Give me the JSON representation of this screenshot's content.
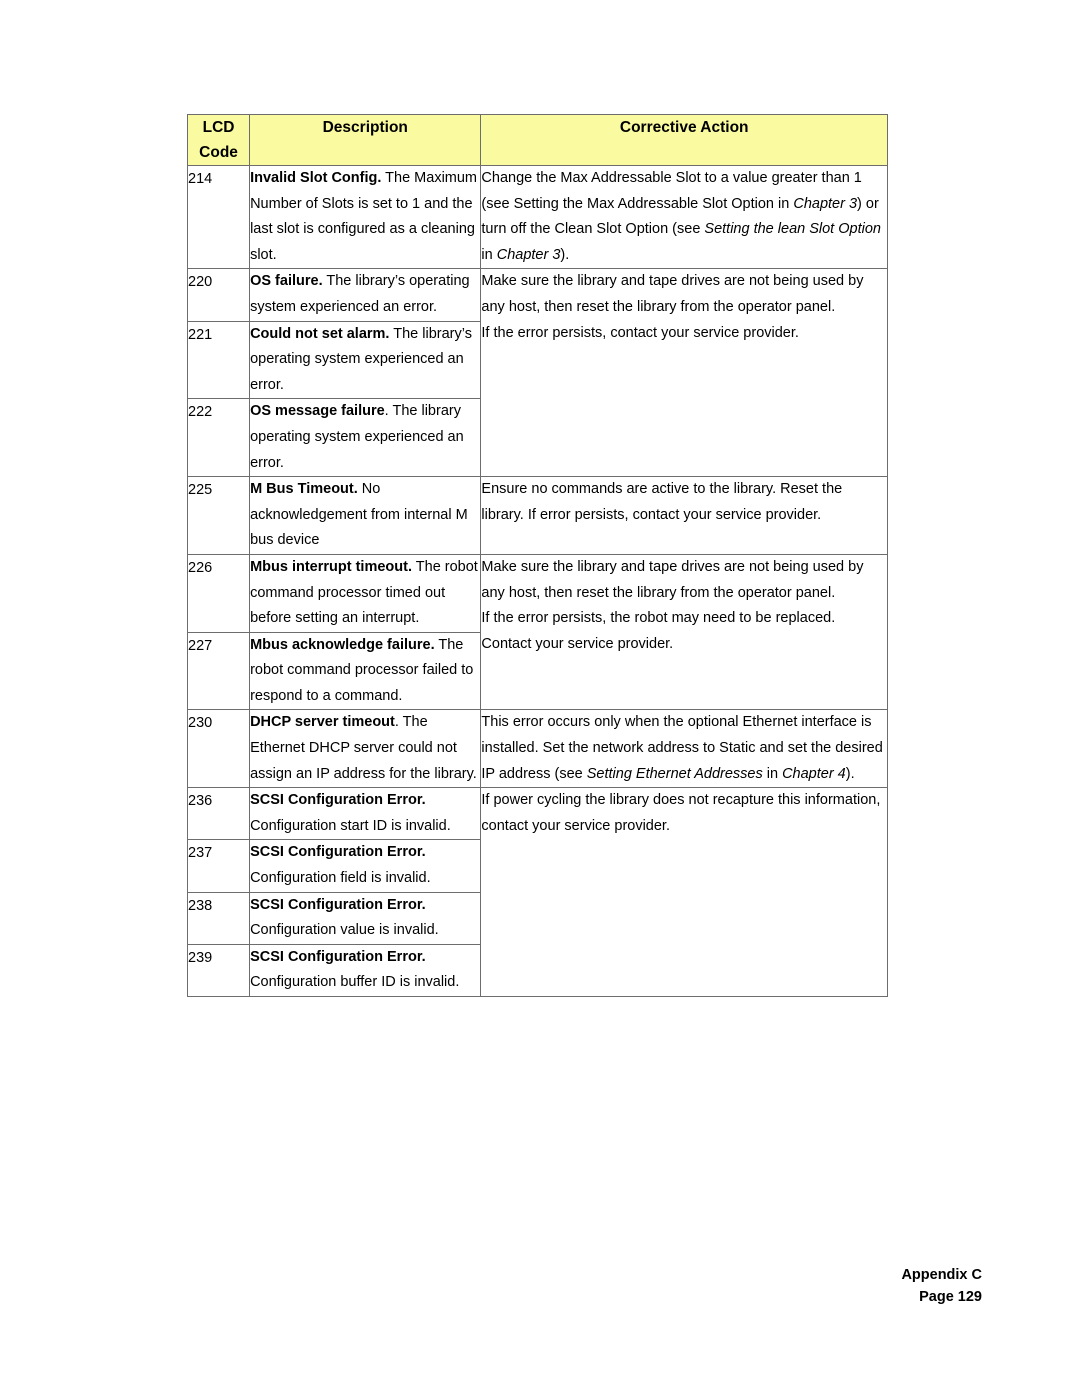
{
  "page": {
    "footer": {
      "appendix": "Appendix C",
      "page_number": "Page 129"
    }
  },
  "table": {
    "headers": {
      "code": "LCD\nCode",
      "code_line1": "LCD",
      "code_line2": "Code",
      "description": "Description",
      "corrective_action": "Corrective Action"
    },
    "header_bg": "#fafaa0",
    "rows": [
      {
        "code": "214",
        "description_html": "<b>Invalid Slot Config.</b> The Maximum Number of Slots is set to 1 and the last slot is configured as a cleaning slot.",
        "description_text": "Invalid Slot Config. The Maximum Number of Slots is set to 1 and the last slot is configured as a cleaning slot.",
        "corrective_html": "Change the Max Addressable Slot to a value greater than 1 (see Setting the Max Addressable Slot Option in <i>Chapter 3</i>) or turn off the Clean Slot Option (see <i>Setting the lean Slot Option</i> in <i>Chapter 3</i>).",
        "corrective_text": "Change the Max Addressable Slot to a value greater than 1 (see Setting the Max Addressable Slot Option in Chapter 3) or turn off the Clean Slot Option (see Setting the lean Slot Option in Chapter 3).",
        "corrective_rowspan": 1
      },
      {
        "code": "220",
        "description_html": "<b>OS failure.</b> The library’s operating system experienced an error.",
        "description_text": "OS failure. The library’s operating system experienced an error.",
        "corrective_html": "Make sure the library and tape drives are not being used by any host, then reset the library from the operator panel.<br>If the error persists, contact your service provider.",
        "corrective_text": "Make sure the library and tape drives are not being used by any host, then reset the library from the operator panel. If the error persists, contact your service provider.",
        "corrective_rowspan": 3
      },
      {
        "code": "221",
        "description_html": "<b>Could not set alarm.</b> The library’s operating system experienced an error.",
        "description_text": "Could not set alarm. The library’s operating system experienced an error.",
        "corrective_html": null,
        "corrective_text": null,
        "corrective_rowspan": 0
      },
      {
        "code": "222",
        "description_html": "<b>OS message failure</b>. The library operating system experienced an error.",
        "description_text": "OS message failure. The library operating system experienced an error.",
        "corrective_html": null,
        "corrective_text": null,
        "corrective_rowspan": 0
      },
      {
        "code": "225",
        "description_html": "<b>M Bus Timeout.</b> No acknowledgement from internal M bus device",
        "description_text": "M Bus Timeout. No acknowledgement from internal M bus device",
        "corrective_html": "Ensure no commands are active to the library. Reset the library. If error persists, contact your service provider.",
        "corrective_text": "Ensure no commands are active to the library. Reset the library. If error persists, contact your service provider.",
        "corrective_rowspan": 1
      },
      {
        "code": "226",
        "description_html": "<b>Mbus interrupt timeout.</b> The robot command processor timed out before setting an interrupt.",
        "description_text": "Mbus interrupt timeout. The robot command processor timed out before setting an interrupt.",
        "corrective_html": "Make sure the library and tape drives are not being used by any host, then reset the library from the operator panel.<br>If the error persists, the robot may need to be replaced. Contact your service provider.",
        "corrective_text": "Make sure the library and tape drives are not being used by any host, then reset the library from the operator panel. If the error persists, the robot may need to be replaced. Contact your service provider.",
        "corrective_rowspan": 2
      },
      {
        "code": "227",
        "description_html": "<b>Mbus acknowledge failure.</b> The robot command processor failed to respond to a command.",
        "description_text": "Mbus acknowledge failure. The robot command processor failed to respond to a command.",
        "corrective_html": null,
        "corrective_text": null,
        "corrective_rowspan": 0
      },
      {
        "code": "230",
        "description_html": "<b>DHCP server timeout</b>. The Ethernet DHCP server could not assign an IP address for the library.",
        "description_text": "DHCP server timeout. The Ethernet DHCP server could not assign an IP address for the library.",
        "corrective_html": "This error occurs only when the optional Ethernet interface is installed. Set the network address to Static and set the desired IP address (see <i>Setting Ethernet Addresses</i> in <i>Chapter 4</i>).",
        "corrective_text": "This error occurs only when the optional Ethernet interface is installed. Set the network address to Static and set the desired IP address (see Setting Ethernet Addresses in Chapter 4).",
        "corrective_rowspan": 1
      },
      {
        "code": "236",
        "description_html": "<b>SCSI Configuration Error.</b> Configuration start ID is invalid.",
        "description_text": "SCSI Configuration Error. Configuration start ID is invalid.",
        "corrective_html": "If power cycling the library does not recapture this information, contact your service provider.",
        "corrective_text": "If power cycling the library does not recapture this information, contact your service provider.",
        "corrective_rowspan": 4
      },
      {
        "code": "237",
        "description_html": "<b>SCSI Configuration Error.</b> Configuration field is invalid.",
        "description_text": "SCSI Configuration Error. Configuration field is invalid.",
        "corrective_html": null,
        "corrective_text": null,
        "corrective_rowspan": 0
      },
      {
        "code": "238",
        "description_html": "<b>SCSI Configuration Error.</b> Configuration value is invalid.",
        "description_text": "SCSI Configuration Error. Configuration value is invalid.",
        "corrective_html": null,
        "corrective_text": null,
        "corrective_rowspan": 0
      },
      {
        "code": "239",
        "description_html": "<b>SCSI Configuration Error.</b> Configuration buffer ID is invalid.",
        "description_text": "SCSI Configuration Error. Configuration buffer ID is invalid.",
        "corrective_html": null,
        "corrective_text": null,
        "corrective_rowspan": 0
      }
    ]
  }
}
